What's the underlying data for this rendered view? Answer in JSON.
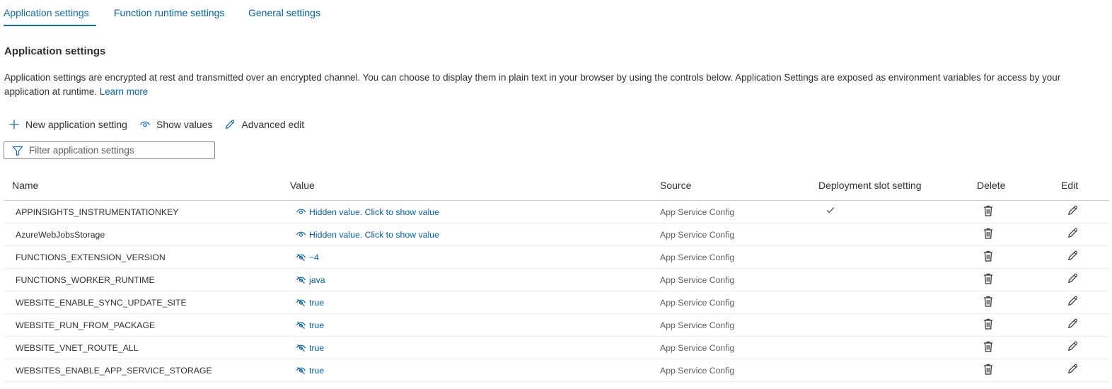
{
  "tabs": [
    {
      "label": "Application settings",
      "active": true
    },
    {
      "label": "Function runtime settings",
      "active": false
    },
    {
      "label": "General settings",
      "active": false
    }
  ],
  "section": {
    "title": "Application settings",
    "description": "Application settings are encrypted at rest and transmitted over an encrypted channel. You can choose to display them in plain text in your browser by using the controls below. Application Settings are exposed as environment variables for access by your application at runtime.",
    "learn_more": "Learn more"
  },
  "toolbar": {
    "new_setting": "New application setting",
    "show_values": "Show values",
    "advanced_edit": "Advanced edit"
  },
  "filter": {
    "placeholder": "Filter application settings"
  },
  "table": {
    "columns": [
      "Name",
      "Value",
      "Source",
      "Deployment slot setting",
      "Delete",
      "Edit"
    ],
    "rows": [
      {
        "name": "APPINSIGHTS_INSTRUMENTATIONKEY",
        "value": "Hidden value. Click to show value",
        "hidden": true,
        "source": "App Service Config",
        "slot": true
      },
      {
        "name": "AzureWebJobsStorage",
        "value": "Hidden value. Click to show value",
        "hidden": true,
        "source": "App Service Config",
        "slot": false
      },
      {
        "name": "FUNCTIONS_EXTENSION_VERSION",
        "value": "~4",
        "hidden": false,
        "source": "App Service Config",
        "slot": false
      },
      {
        "name": "FUNCTIONS_WORKER_RUNTIME",
        "value": "java",
        "hidden": false,
        "source": "App Service Config",
        "slot": false
      },
      {
        "name": "WEBSITE_ENABLE_SYNC_UPDATE_SITE",
        "value": "true",
        "hidden": false,
        "source": "App Service Config",
        "slot": false
      },
      {
        "name": "WEBSITE_RUN_FROM_PACKAGE",
        "value": "true",
        "hidden": false,
        "source": "App Service Config",
        "slot": false
      },
      {
        "name": "WEBSITE_VNET_ROUTE_ALL",
        "value": "true",
        "hidden": false,
        "source": "App Service Config",
        "slot": false
      },
      {
        "name": "WEBSITES_ENABLE_APP_SERVICE_STORAGE",
        "value": "true",
        "hidden": false,
        "source": "App Service Config",
        "slot": false
      }
    ]
  },
  "icons": {
    "new": "plus-icon",
    "show": "eye-icon",
    "advanced": "pencil-icon",
    "filter": "filter-icon",
    "hidden_value": "eye-icon",
    "visible_value": "eye-off-icon",
    "slot": "checkmark-icon",
    "delete": "trash-icon",
    "edit": "pencil-icon"
  },
  "colors": {
    "accent": "#0f6cbd",
    "link": "#0062ad",
    "text": "#323130"
  }
}
